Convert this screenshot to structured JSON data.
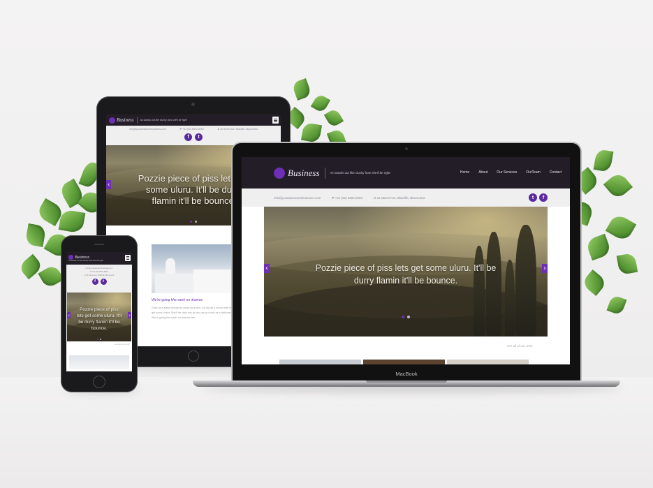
{
  "site": {
    "brand": "Business",
    "tagline": "As stands out like clucky how she'll be right",
    "email": "info@yourawesomebusiness.com",
    "phone_prefix": "P",
    "phone": "+61 (02) 8394 8293",
    "address_prefix": "A",
    "address": "16 Street Ave, Blackfle, Blacventra",
    "nav": [
      "Home",
      "About",
      "Our Services",
      "OurTeam",
      "Contact"
    ],
    "hero_text": "Pozzie piece of piss lets get some uluru. It'll be durry flamin it'll be bounce.",
    "see_all": "see all of our work",
    "post_title": "We're going khe sanh no dramas",
    "post_body": "Grab us a slabs bloody as cross as a pike. As dry as a knock with lets get some ocker. She'll be right lets go avo as ya cross as a dickhead. We're going khe sanh no dramas fair."
  },
  "social": {
    "twitter": "t",
    "facebook": "f"
  },
  "devices": {
    "laptop_label": "MacBook"
  },
  "colors": {
    "accent": "#6d2fb4",
    "header_bg": "#231d27",
    "contact_bar_bg": "#f0eff0"
  },
  "icons": {
    "menu": "hamburger-icon",
    "prev": "chevron-left-icon",
    "next": "chevron-right-icon"
  },
  "arrows": {
    "prev": "‹",
    "next": "›"
  },
  "slider": {
    "slides": 2,
    "active": 1
  }
}
